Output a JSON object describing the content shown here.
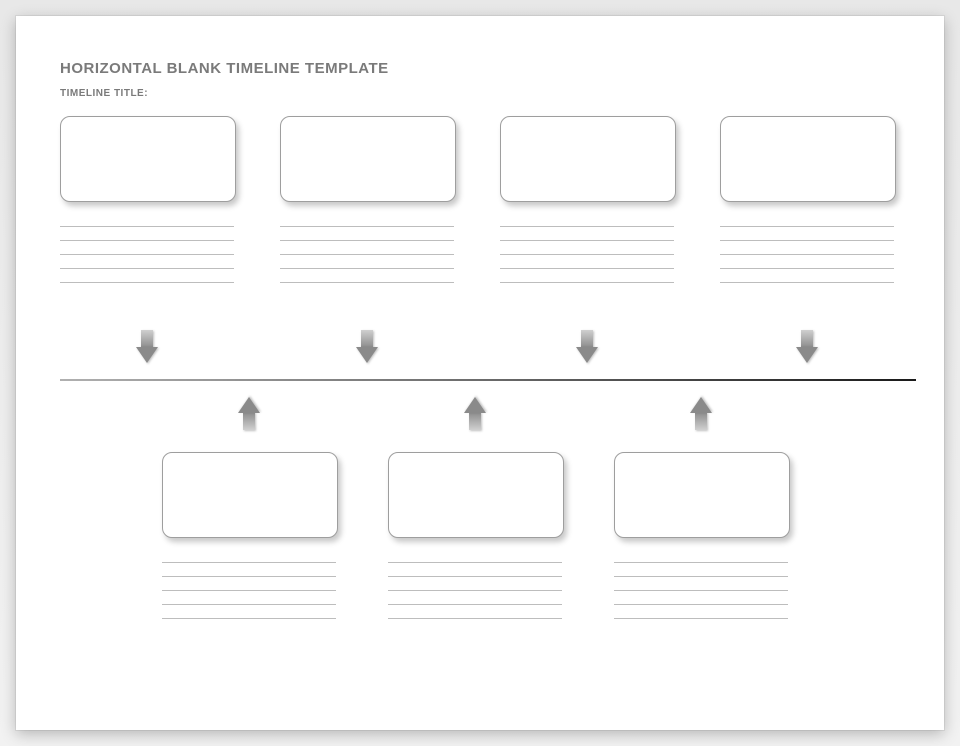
{
  "header": {
    "title": "HORIZONTAL BLANK TIMELINE TEMPLATE",
    "subtitle": "TIMELINE TITLE:"
  },
  "timeline": {
    "above": [
      {
        "card_text": "",
        "lines": [
          "",
          "",
          "",
          "",
          ""
        ]
      },
      {
        "card_text": "",
        "lines": [
          "",
          "",
          "",
          "",
          ""
        ]
      },
      {
        "card_text": "",
        "lines": [
          "",
          "",
          "",
          "",
          ""
        ]
      },
      {
        "card_text": "",
        "lines": [
          "",
          "",
          "",
          "",
          ""
        ]
      }
    ],
    "below": [
      {
        "card_text": "",
        "lines": [
          "",
          "",
          "",
          "",
          ""
        ]
      },
      {
        "card_text": "",
        "lines": [
          "",
          "",
          "",
          "",
          ""
        ]
      },
      {
        "card_text": "",
        "lines": [
          "",
          "",
          "",
          "",
          ""
        ]
      }
    ]
  }
}
